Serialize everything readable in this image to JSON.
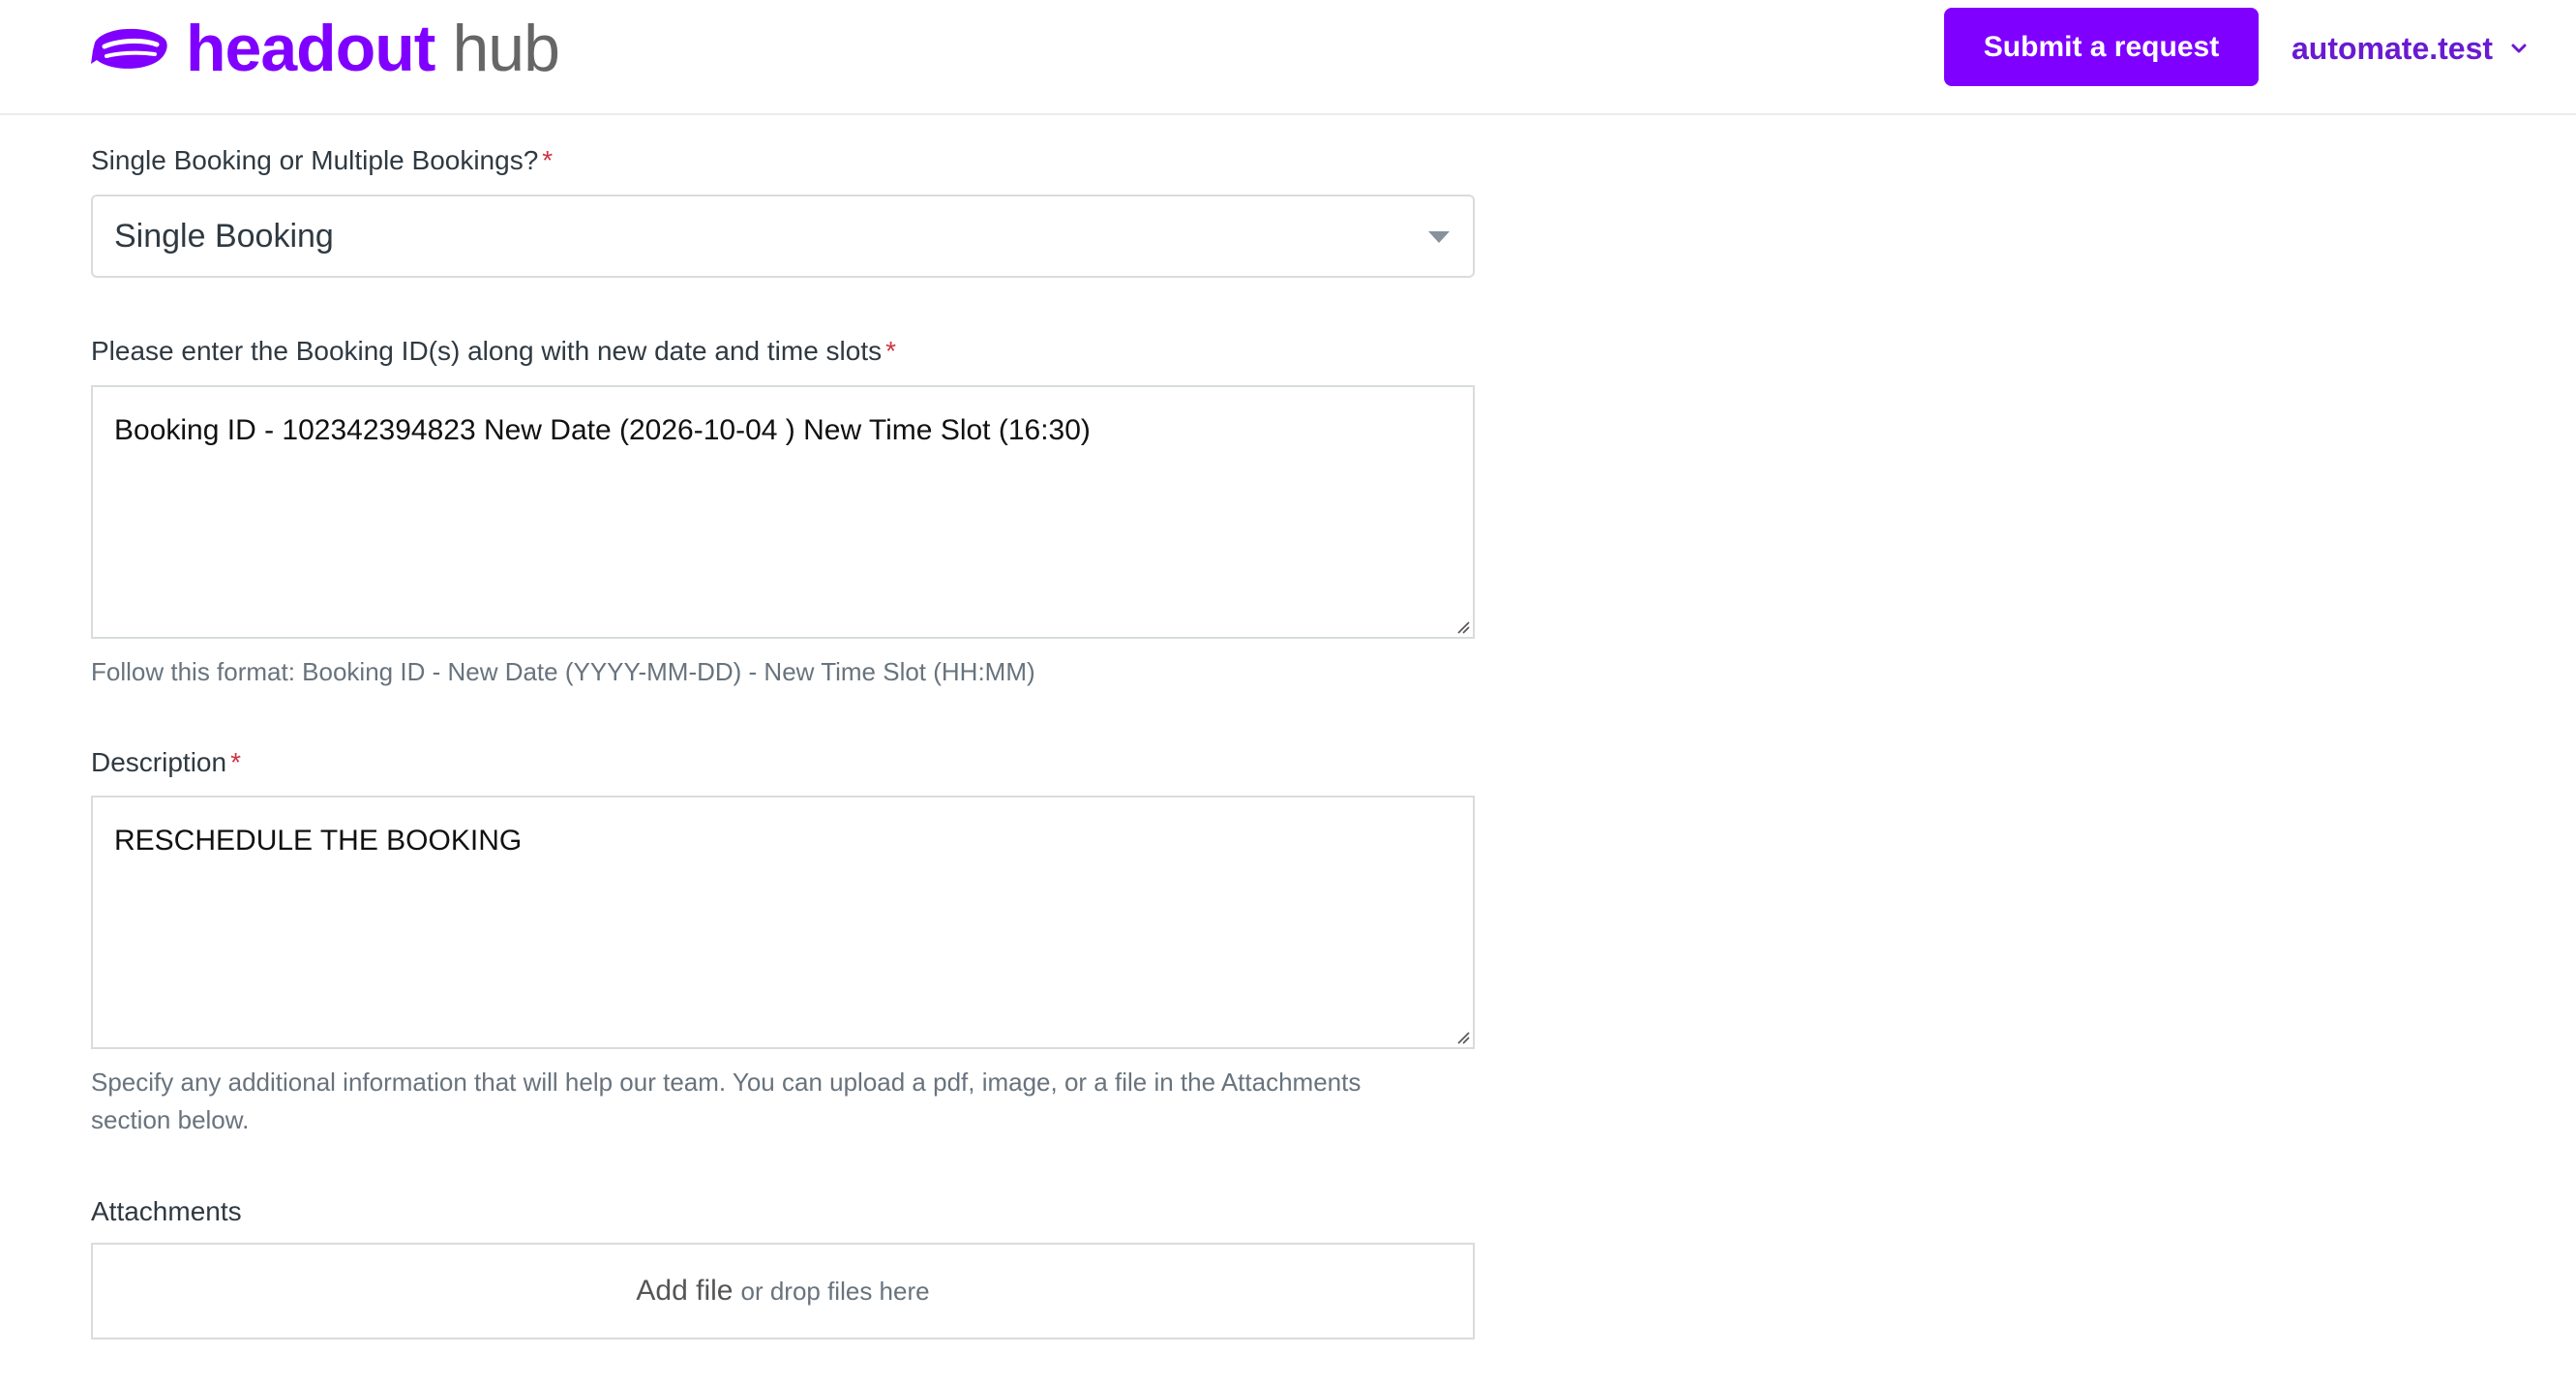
{
  "header": {
    "brand": "headout",
    "product": "hub",
    "submit_label": "Submit a request",
    "user_name": "automate.test",
    "brand_color": "#8000ff"
  },
  "form": {
    "booking_type": {
      "label": "Single Booking or Multiple Bookings?",
      "required_mark": "*",
      "value": "Single Booking"
    },
    "booking_ids": {
      "label": "Please enter the Booking ID(s) along with new date and time slots",
      "required_mark": "*",
      "value": "Booking ID - 102342394823 New Date (2026-10-04 ) New Time Slot (16:30)",
      "hint": "Follow this format: Booking ID - New Date (YYYY-MM-DD) - New Time Slot (HH:MM)"
    },
    "description": {
      "label": "Description",
      "required_mark": "*",
      "value": "RESCHEDULE THE BOOKING",
      "hint_line1": "Specify any additional information that will help our team. You can upload a pdf, image, or a file in the Attachments",
      "hint_line2": "section below."
    },
    "attachments": {
      "label": "Attachments",
      "add_file": "Add file",
      "drop_text": "or drop files here"
    }
  }
}
